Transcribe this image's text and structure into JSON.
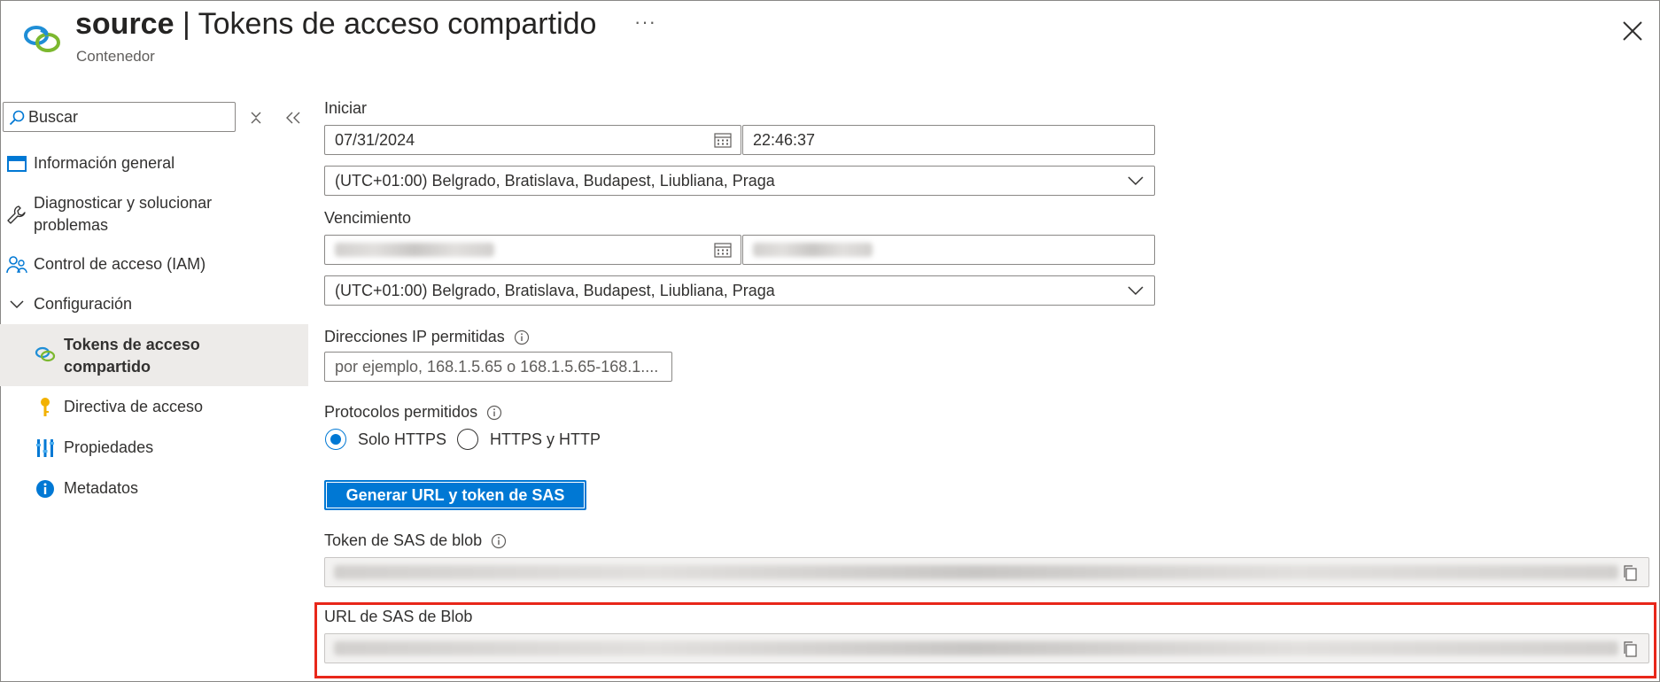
{
  "header": {
    "title_resource": "source",
    "title_separator": "|",
    "title_page": "Tokens de acceso compartido",
    "subtitle": "Contenedor",
    "more_label": "···",
    "icon": "shared-access-token-icon",
    "close_icon": "close-icon"
  },
  "sidebar": {
    "search_placeholder": "Buscar",
    "items": [
      {
        "label": "Información general",
        "icon": "overview-icon"
      },
      {
        "label": "Diagnosticar y solucionar problemas",
        "icon": "wrench-icon"
      },
      {
        "label": "Control de acceso (IAM)",
        "icon": "people-icon"
      },
      {
        "label": "Configuración",
        "icon": "chevron-down-icon",
        "expanded": true
      },
      {
        "label": "Tokens de acceso compartido",
        "icon": "shared-access-token-icon",
        "selected": true
      },
      {
        "label": "Directiva de acceso",
        "icon": "key-icon"
      },
      {
        "label": "Propiedades",
        "icon": "properties-icon"
      },
      {
        "label": "Metadatos",
        "icon": "info-icon"
      }
    ]
  },
  "form": {
    "start": {
      "label": "Iniciar",
      "date": "07/31/2024",
      "time": "22:46:37",
      "timezone": "(UTC+01:00) Belgrado, Bratislava, Budapest, Liubliana, Praga"
    },
    "expiry": {
      "label": "Vencimiento",
      "timezone": "(UTC+01:00) Belgrado, Bratislava, Budapest, Liubliana, Praga"
    },
    "allowed_ips": {
      "label": "Direcciones IP permitidas",
      "placeholder": "por ejemplo, 168.1.5.65 o 168.1.5.65-168.1...."
    },
    "protocols": {
      "label": "Protocolos permitidos",
      "options": [
        {
          "label": "Solo HTTPS",
          "selected": true
        },
        {
          "label": "HTTPS y HTTP",
          "selected": false
        }
      ]
    },
    "generate_button": "Generar URL y token de SAS",
    "blob_token": {
      "label": "Token de SAS de blob"
    },
    "blob_url": {
      "label": "URL de SAS de Blob"
    }
  },
  "colors": {
    "accent": "#0078d4",
    "highlight_border": "#e8271a",
    "selected_nav_bg": "#edebe9"
  }
}
